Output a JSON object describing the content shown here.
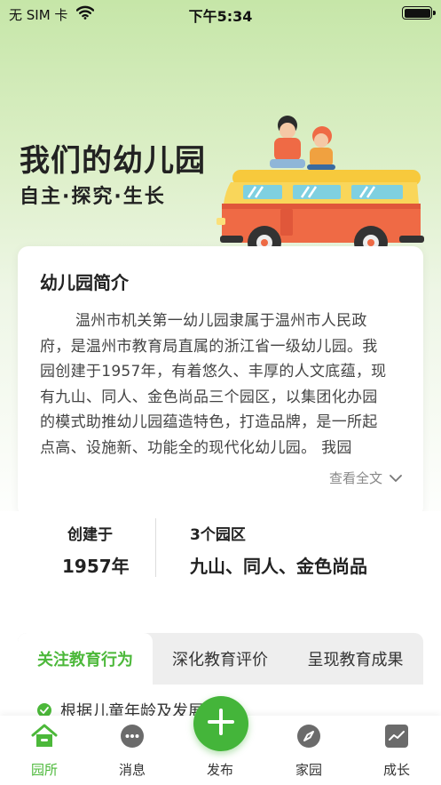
{
  "status_bar": {
    "carrier": "无 SIM 卡",
    "time": "下午5:34"
  },
  "hero": {
    "title": "我们的幼儿园",
    "subtitle": "自主·探究·生长"
  },
  "intro": {
    "heading": "幼儿园简介",
    "body": "温州市机关第一幼儿园隶属于温州市人民政府，是温州市教育局直属的浙江省一级幼儿园。我园创建于1957年，有着悠久、丰厚的人文底蕴，现有九山、同人、金色尚品三个园区，以集团化办园的模式助推幼儿园蕴造特色，打造品牌，是一所起点高、设施新、功能全的现代化幼儿园。 我园",
    "read_more": "查看全文"
  },
  "stats": {
    "founded_label": "创建于",
    "founded_value": "1957年",
    "campus_label": "3个园区",
    "campus_value": "九山、同人、金色尚品"
  },
  "tabs": [
    {
      "label": "关注教育行为",
      "active": true
    },
    {
      "label": "深化教育评价",
      "active": false
    },
    {
      "label": "呈现教育成果",
      "active": false
    }
  ],
  "content": {
    "first_item": "根据儿童年龄及发展"
  },
  "bottom_nav": [
    {
      "label": "园所",
      "icon": "home-icon",
      "active": true
    },
    {
      "label": "消息",
      "icon": "message-icon",
      "active": false
    },
    {
      "label": "发布",
      "icon": "plus-icon",
      "active": false
    },
    {
      "label": "家园",
      "icon": "compass-icon",
      "active": false
    },
    {
      "label": "成长",
      "icon": "chart-icon",
      "active": false
    }
  ],
  "colors": {
    "accent": "#4cb83a",
    "hero_gradient_top": "#c6e6a8",
    "bus_orange": "#ef6a45",
    "bus_yellow": "#f7c93c"
  }
}
